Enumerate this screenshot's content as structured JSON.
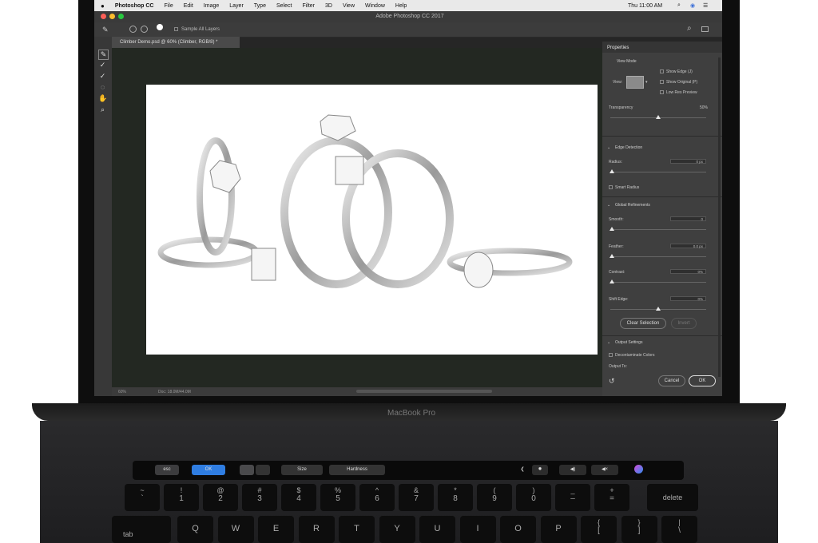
{
  "menubar": {
    "apple": "",
    "items": [
      "Photoshop CC",
      "File",
      "Edit",
      "Image",
      "Layer",
      "Type",
      "Select",
      "Filter",
      "3D",
      "View",
      "Window",
      "Help"
    ],
    "clock": "Thu 11:00 AM"
  },
  "titlebar": {
    "title": "Adobe Photoshop CC 2017"
  },
  "options": {
    "sample_all_layers": "Sample All Layers"
  },
  "document": {
    "tab": "Climber Demo.psd @ 60% (Climber, RGB/8) *",
    "zoom": "60%",
    "doc_info": "Doc: 18.0M/44.0M"
  },
  "panel": {
    "title": "Properties",
    "view_mode": "View Mode",
    "view_label": "View:",
    "show_edge": "Show Edge (J)",
    "show_original": "Show Original (P)",
    "low_res": "Low Res Preview",
    "transparency_label": "Transparency",
    "transparency_value": "50%",
    "transparency_level": 0.5,
    "edge_detection": "Edge Detection",
    "radius_label": "Radius:",
    "radius_value": "0 px",
    "smart_radius": "Smart Radius",
    "global_refinements": "Global Refinements",
    "smooth_label": "Smooth:",
    "smooth_value": "0",
    "feather_label": "Feather:",
    "feather_value": "0.0 px",
    "contrast_label": "Contrast:",
    "contrast_value": "0%",
    "shift_edge_label": "Shift Edge:",
    "shift_edge_value": "0%",
    "clear_selection": "Clear Selection",
    "invert": "Invert",
    "output_settings": "Output Settings",
    "decontaminate": "Decontaminate Colors",
    "output_to": "Output To:",
    "cancel": "Cancel",
    "ok": "OK"
  },
  "laptop": {
    "brand": "MacBook Pro"
  },
  "touchbar": {
    "esc": "esc",
    "ok": "OK",
    "size": "Size",
    "hardness": "Hardness"
  },
  "keys": {
    "row1": [
      [
        "~",
        "`"
      ],
      [
        "!",
        "1"
      ],
      [
        "@",
        "2"
      ],
      [
        "#",
        "3"
      ],
      [
        "$",
        "4"
      ],
      [
        "%",
        "5"
      ],
      [
        "^",
        "6"
      ],
      [
        "&",
        "7"
      ],
      [
        "*",
        "8"
      ],
      [
        "(",
        "9"
      ],
      [
        ")",
        "0"
      ],
      [
        "_",
        "–"
      ],
      [
        "+",
        "="
      ]
    ],
    "delete": "delete",
    "tab": "tab",
    "row2": [
      "Q",
      "W",
      "E",
      "R",
      "T",
      "Y",
      "U",
      "I",
      "O",
      "P"
    ],
    "row2_extra": [
      [
        "{",
        "["
      ],
      [
        "}",
        "]"
      ],
      [
        "|",
        "\\"
      ]
    ]
  }
}
